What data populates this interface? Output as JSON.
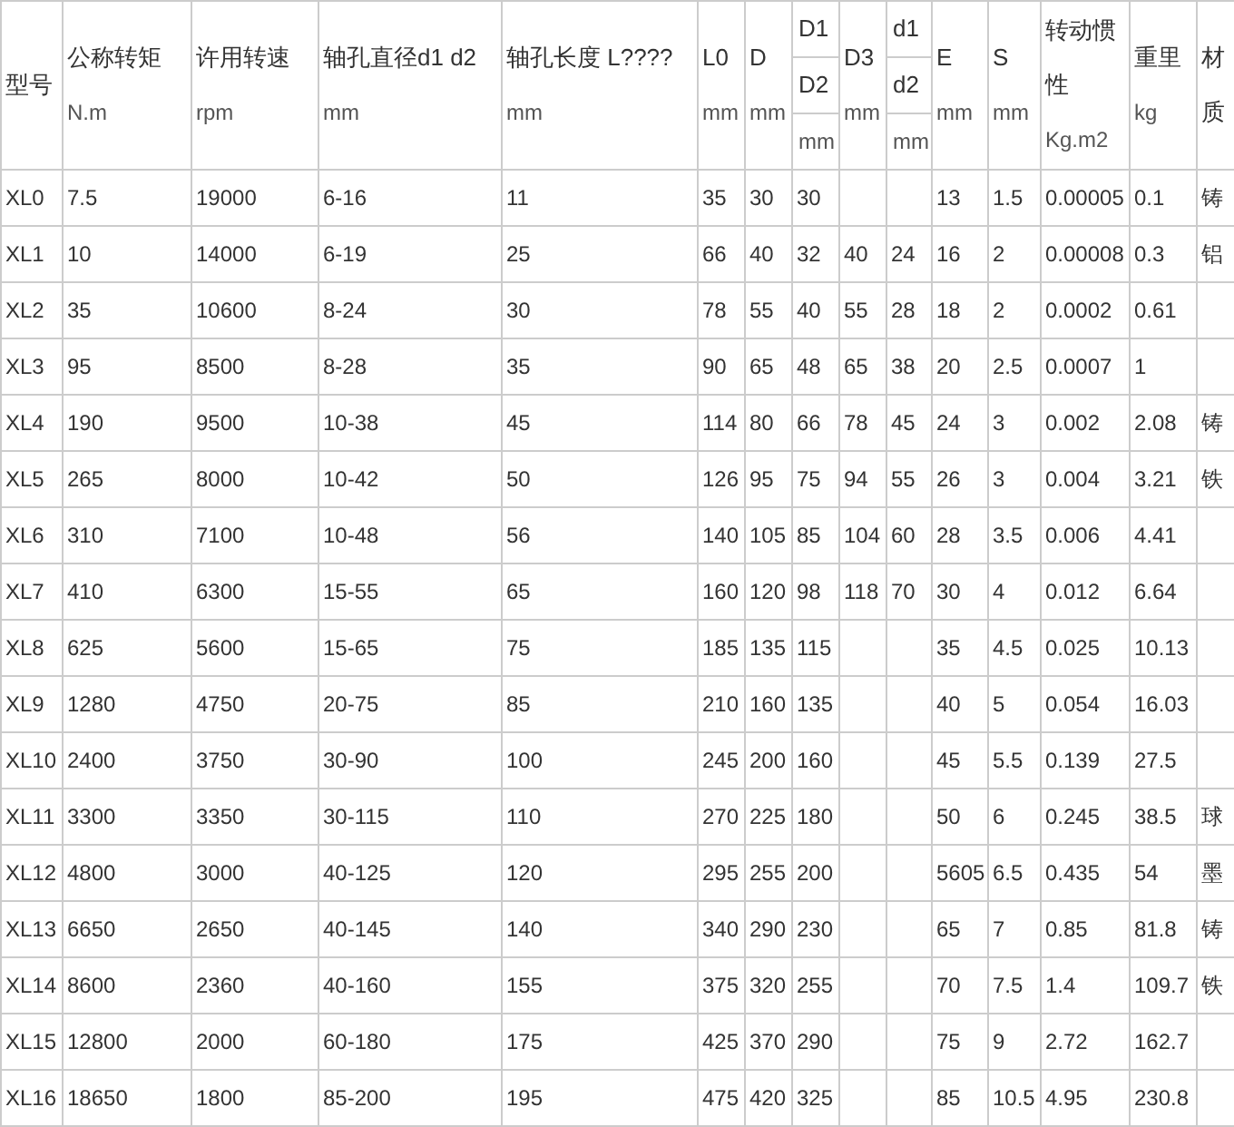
{
  "header": [
    {
      "kind": "single",
      "label": "型号"
    },
    {
      "kind": "single",
      "label": "公称转矩",
      "unit": "N.m"
    },
    {
      "kind": "single",
      "label": "许用转速",
      "unit": "rpm"
    },
    {
      "kind": "single",
      "label": "轴孔直径d1 d2",
      "unit": "mm"
    },
    {
      "kind": "single",
      "label": "轴孔长度 L????",
      "unit": "mm"
    },
    {
      "kind": "single",
      "label": "L0",
      "unit": "mm"
    },
    {
      "kind": "single",
      "label": "D",
      "unit": "mm"
    },
    {
      "kind": "stacked",
      "top": "D1",
      "middle": "D2",
      "unit": "mm"
    },
    {
      "kind": "single",
      "label": "D3",
      "unit": "mm"
    },
    {
      "kind": "stacked",
      "top": "d1",
      "middle": "d2",
      "unit": "mm"
    },
    {
      "kind": "single",
      "label": "E",
      "unit": "mm"
    },
    {
      "kind": "single",
      "label": "S",
      "unit": "mm"
    },
    {
      "kind": "single",
      "label": "转动惯性",
      "unit": "Kg.m2"
    },
    {
      "kind": "single",
      "label": "重里",
      "unit": "kg"
    },
    {
      "kind": "single",
      "label": "材质"
    }
  ],
  "rows": [
    [
      "XL0",
      "7.5",
      "19000",
      "6-16",
      "11",
      "35",
      "30",
      "30",
      null,
      null,
      "13",
      "1.5",
      "0.00005",
      "0.1",
      "铸"
    ],
    [
      "XL1",
      "10",
      "14000",
      "6-19",
      "25",
      "66",
      "40",
      "32",
      "40",
      "24",
      "16",
      "2",
      "0.00008",
      "0.3",
      "铝"
    ],
    [
      "XL2",
      "35",
      "10600",
      "8-24",
      "30",
      "78",
      "55",
      "40",
      "55",
      "28",
      "18",
      "2",
      "0.0002",
      "0.61",
      null
    ],
    [
      "XL3",
      "95",
      "8500",
      "8-28",
      "35",
      "90",
      "65",
      "48",
      "65",
      "38",
      "20",
      "2.5",
      "0.0007",
      "1",
      null
    ],
    [
      "XL4",
      "190",
      "9500",
      "10-38",
      "45",
      "114",
      "80",
      "66",
      "78",
      "45",
      "24",
      "3",
      "0.002",
      "2.08",
      "铸"
    ],
    [
      "XL5",
      "265",
      "8000",
      "10-42",
      "50",
      "126",
      "95",
      "75",
      "94",
      "55",
      "26",
      "3",
      "0.004",
      "3.21",
      "铁"
    ],
    [
      "XL6",
      "310",
      "7100",
      "10-48",
      "56",
      "140",
      "105",
      "85",
      "104",
      "60",
      "28",
      "3.5",
      "0.006",
      "4.41",
      null
    ],
    [
      "XL7",
      "410",
      "6300",
      "15-55",
      "65",
      "160",
      "120",
      "98",
      "118",
      "70",
      "30",
      "4",
      "0.012",
      "6.64",
      null
    ],
    [
      "XL8",
      "625",
      "5600",
      "15-65",
      "75",
      "185",
      "135",
      "115",
      null,
      null,
      "35",
      "4.5",
      "0.025",
      "10.13",
      null
    ],
    [
      "XL9",
      "1280",
      "4750",
      "20-75",
      "85",
      "210",
      "160",
      "135",
      null,
      null,
      "40",
      "5",
      "0.054",
      "16.03",
      null
    ],
    [
      "XL10",
      "2400",
      "3750",
      "30-90",
      "100",
      "245",
      "200",
      "160",
      null,
      null,
      "45",
      "5.5",
      "0.139",
      "27.5",
      null
    ],
    [
      "XL11",
      "3300",
      "3350",
      "30-115",
      "110",
      "270",
      "225",
      "180",
      null,
      null,
      "50",
      "6",
      "0.245",
      "38.5",
      "球"
    ],
    [
      "XL12",
      "4800",
      "3000",
      "40-125",
      "120",
      "295",
      "255",
      "200",
      null,
      null,
      "5605",
      "6.5",
      "0.435",
      "54",
      "墨"
    ],
    [
      "XL13",
      "6650",
      "2650",
      "40-145",
      "140",
      "340",
      "290",
      "230",
      null,
      null,
      "65",
      "7",
      "0.85",
      "81.8",
      "铸"
    ],
    [
      "XL14",
      "8600",
      "2360",
      "40-160",
      "155",
      "375",
      "320",
      "255",
      null,
      null,
      "70",
      "7.5",
      "1.4",
      "109.7",
      "铁"
    ],
    [
      "XL15",
      "12800",
      "2000",
      "60-180",
      "175",
      "425",
      "370",
      "290",
      null,
      null,
      "75",
      "9",
      "2.72",
      "162.7",
      null
    ],
    [
      "XL16",
      "18650",
      "1800",
      "85-200",
      "195",
      "475",
      "420",
      "325",
      null,
      null,
      "85",
      "10.5",
      "4.95",
      "230.8",
      null
    ]
  ]
}
